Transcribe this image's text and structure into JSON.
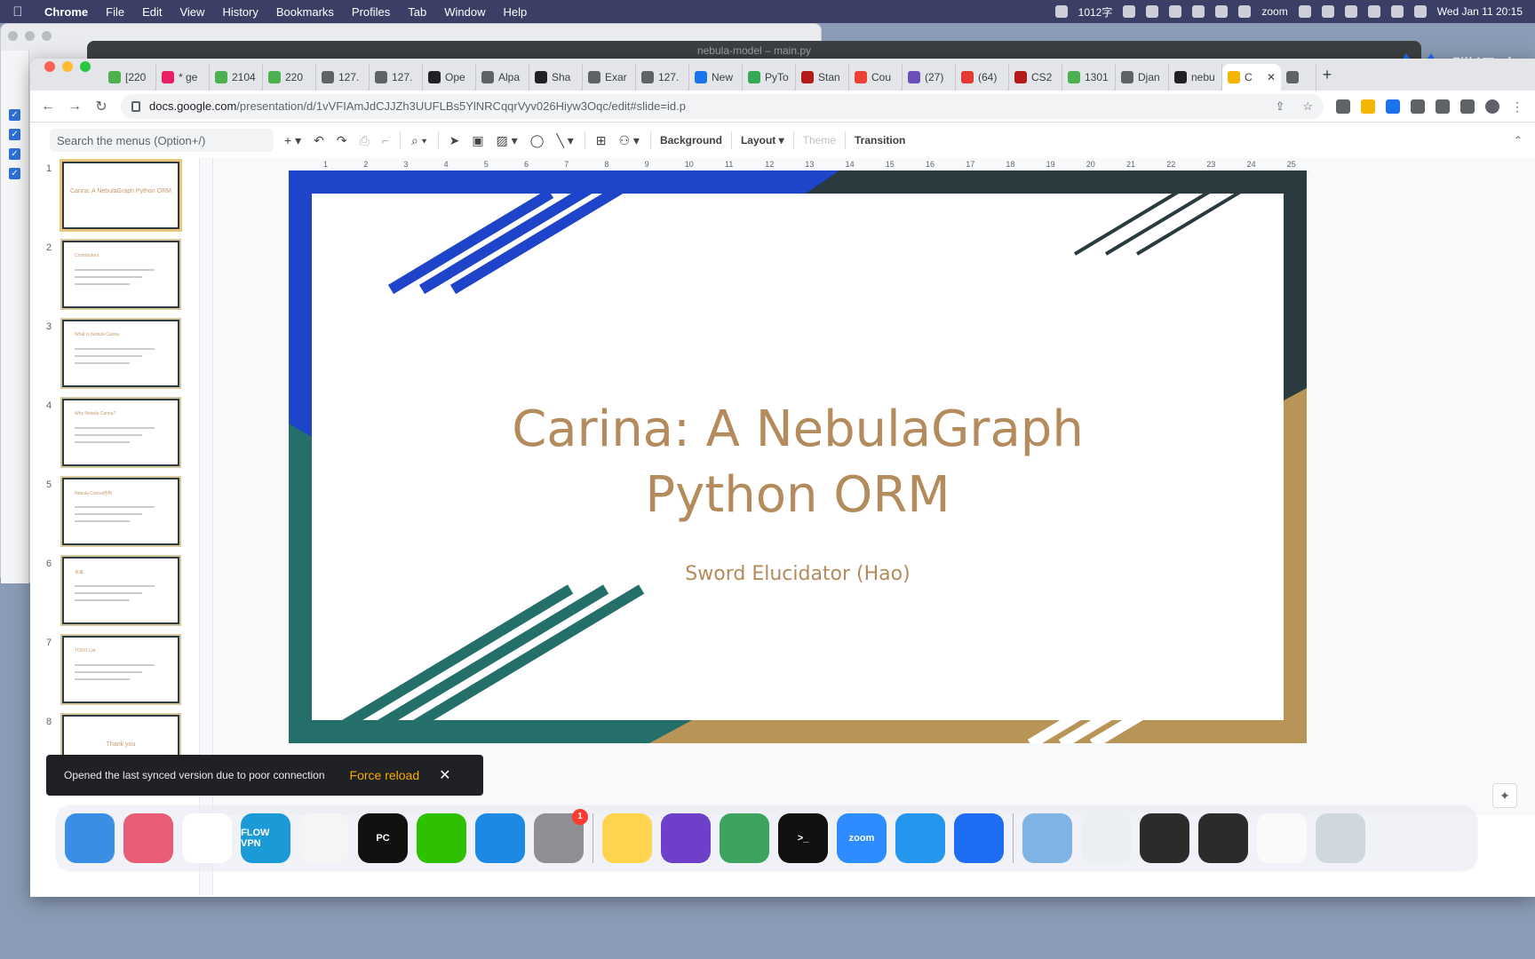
{
  "menubar": {
    "app_name": "Chrome",
    "menus": [
      "File",
      "Edit",
      "View",
      "History",
      "Bookmarks",
      "Profiles",
      "Tab",
      "Window",
      "Help"
    ],
    "status_text": "1012字",
    "zoom_label": "zoom",
    "clock": "Wed Jan 11  20:15"
  },
  "bg_window": {
    "title": "nebula-model – main.py"
  },
  "tencent_label": "腾讯会",
  "tabs": [
    {
      "label": "[220",
      "icon_color": "#4caf50"
    },
    {
      "label": "* ge",
      "icon_color": "#e91e63"
    },
    {
      "label": "2104",
      "icon_color": "#4caf50"
    },
    {
      "label": "220",
      "icon_color": "#4caf50"
    },
    {
      "label": "127.",
      "icon_color": "#5f6368"
    },
    {
      "label": "127.",
      "icon_color": "#5f6368"
    },
    {
      "label": "Ope",
      "icon_color": "#202124"
    },
    {
      "label": "Alpa",
      "icon_color": "#5f6368"
    },
    {
      "label": "Sha",
      "icon_color": "#202124"
    },
    {
      "label": "Exar",
      "icon_color": "#5f6368"
    },
    {
      "label": "127.",
      "icon_color": "#5f6368"
    },
    {
      "label": "New",
      "icon_color": "#1a73e8"
    },
    {
      "label": "PyTo",
      "icon_color": "#34a853"
    },
    {
      "label": "Stan",
      "icon_color": "#b31b1b"
    },
    {
      "label": "Cou",
      "icon_color": "#ea4335"
    },
    {
      "label": "(27)",
      "icon_color": "#6b4fbb"
    },
    {
      "label": "(64)",
      "icon_color": "#e53935"
    },
    {
      "label": "CS2",
      "icon_color": "#b31b1b"
    },
    {
      "label": "1301",
      "icon_color": "#4caf50"
    },
    {
      "label": "Djan",
      "icon_color": "#5f6368"
    },
    {
      "label": "nebu",
      "icon_color": "#202124"
    }
  ],
  "active_tab": {
    "label": "C",
    "icon_color": "#f4b400"
  },
  "url": {
    "host": "docs.google.com",
    "path": "/presentation/d/1vVFIAmJdCJJZh3UUFLBs5YlNRCqqrVyv026Hiyw3Oqc/edit#slide=id.p"
  },
  "toolbar": {
    "menu_search_placeholder": "Search the menus (Option+/)",
    "background_label": "Background",
    "layout_label": "Layout",
    "theme_label": "Theme",
    "transition_label": "Transition"
  },
  "filmstrip": [
    {
      "num": "1",
      "title": "Carina: A NebulaGraph Python ORM"
    },
    {
      "num": "2",
      "title": "Contributors"
    },
    {
      "num": "3",
      "title": "What is Nebula Carina"
    },
    {
      "num": "4",
      "title": "Why Nebula Carina?"
    },
    {
      "num": "5",
      "title": "Nebula Carina结构"
    },
    {
      "num": "6",
      "title": "未来"
    },
    {
      "num": "7",
      "title": "TODO List"
    },
    {
      "num": "8",
      "title": "Thank you"
    }
  ],
  "ruler_numbers": [
    "1",
    "2",
    "3",
    "4",
    "5",
    "6",
    "7",
    "8",
    "9",
    "10",
    "11",
    "12",
    "13",
    "14",
    "15",
    "16",
    "17",
    "18",
    "19",
    "20",
    "21",
    "22",
    "23",
    "24",
    "25"
  ],
  "slide": {
    "title_line1": "Carina: A NebulaGraph",
    "title_line2": "Python ORM",
    "subtitle": "Sword Elucidator (Hao)"
  },
  "toast": {
    "message": "Opened the last synced version due to poor connection",
    "action": "Force reload"
  },
  "dock": [
    {
      "name": "finder",
      "label": "",
      "color": "#3a8ee6"
    },
    {
      "name": "launchpad",
      "label": "",
      "color": "#e85d75"
    },
    {
      "name": "chrome",
      "label": "",
      "color": "#ffffff"
    },
    {
      "name": "flowvpn",
      "label": "FLOW VPN",
      "color": "#1a9bd7"
    },
    {
      "name": "reminders",
      "label": "",
      "color": "#f5f5f5"
    },
    {
      "name": "pycharm",
      "label": "PC",
      "color": "#111111"
    },
    {
      "name": "wechat",
      "label": "",
      "color": "#2dc100"
    },
    {
      "name": "appstore",
      "label": "",
      "color": "#1e88e5"
    },
    {
      "name": "settings",
      "label": "",
      "color": "#8e8e93",
      "badge": "1"
    },
    {
      "name": "notes",
      "label": "",
      "color": "#ffd54f"
    },
    {
      "name": "github",
      "label": "",
      "color": "#6e40c9"
    },
    {
      "name": "safari-like",
      "label": "",
      "color": "#3ea35c"
    },
    {
      "name": "terminal",
      "label": ">_",
      "color": "#111111"
    },
    {
      "name": "zoom",
      "label": "zoom",
      "color": "#2d8cff"
    },
    {
      "name": "docker",
      "label": "",
      "color": "#2496ed"
    },
    {
      "name": "tencent-meeting",
      "label": "",
      "color": "#1d6cf2"
    },
    {
      "name": "downloads",
      "label": "",
      "color": "#7fb2e5"
    },
    {
      "name": "window-1",
      "label": "",
      "color": "#eceff1"
    },
    {
      "name": "window-2",
      "label": "",
      "color": "#2b2b2b"
    },
    {
      "name": "window-3",
      "label": "",
      "color": "#2b2b2b"
    },
    {
      "name": "preview",
      "label": "",
      "color": "#fafafa"
    },
    {
      "name": "trash",
      "label": "",
      "color": "#cfd8dc"
    }
  ]
}
